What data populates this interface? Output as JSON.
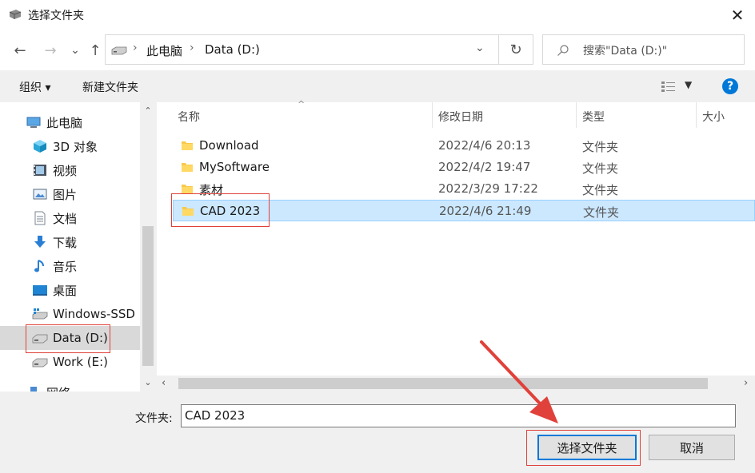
{
  "window": {
    "title": "选择文件夹",
    "close_glyph": "✕"
  },
  "nav": {
    "back_glyph": "←",
    "forward_glyph": "→",
    "recent_glyph": "⌄",
    "up_glyph": "↑",
    "breadcrumb": [
      "此电脑",
      "Data (D:)"
    ],
    "refresh_glyph": "↻",
    "search_placeholder": "搜索\"Data (D:)\""
  },
  "toolbar": {
    "organize_label": "组织 ▾",
    "new_folder_label": "新建文件夹",
    "help_glyph": "?"
  },
  "sidebar": {
    "items": [
      {
        "label": "此电脑",
        "icon": "pc-icon",
        "indent": 1
      },
      {
        "label": "3D 对象",
        "icon": "cube-3d-icon",
        "indent": 2
      },
      {
        "label": "视频",
        "icon": "video-icon",
        "indent": 2
      },
      {
        "label": "图片",
        "icon": "picture-icon",
        "indent": 2
      },
      {
        "label": "文档",
        "icon": "document-icon",
        "indent": 2
      },
      {
        "label": "下载",
        "icon": "download-icon",
        "indent": 2
      },
      {
        "label": "音乐",
        "icon": "music-icon",
        "indent": 2
      },
      {
        "label": "桌面",
        "icon": "desktop-icon",
        "indent": 2
      },
      {
        "label": "Windows-SSD (",
        "icon": "windows-drive-icon",
        "indent": 2
      },
      {
        "label": "Data (D:)",
        "icon": "drive-icon",
        "indent": 2,
        "selected": true
      },
      {
        "label": "Work (E:)",
        "icon": "drive-icon",
        "indent": 2
      },
      {
        "label": "网络",
        "icon": "network-icon",
        "indent": 1
      }
    ]
  },
  "columns": {
    "name": "名称",
    "modified": "修改日期",
    "type": "类型",
    "size": "大小"
  },
  "files": [
    {
      "name": "Download",
      "modified": "2022/4/6 20:13",
      "type": "文件夹"
    },
    {
      "name": "MySoftware",
      "modified": "2022/4/2 19:47",
      "type": "文件夹"
    },
    {
      "name": "素材",
      "modified": "2022/3/29 17:22",
      "type": "文件夹"
    },
    {
      "name": "CAD 2023",
      "modified": "2022/4/6 21:49",
      "type": "文件夹",
      "selected": true
    }
  ],
  "footer": {
    "folder_label": "文件夹:",
    "folder_value": "CAD 2023",
    "select_button": "选择文件夹",
    "cancel_button": "取消"
  },
  "colors": {
    "accent": "#0078d7",
    "selected_row": "#cce8ff",
    "annotation": "#e0413a"
  }
}
